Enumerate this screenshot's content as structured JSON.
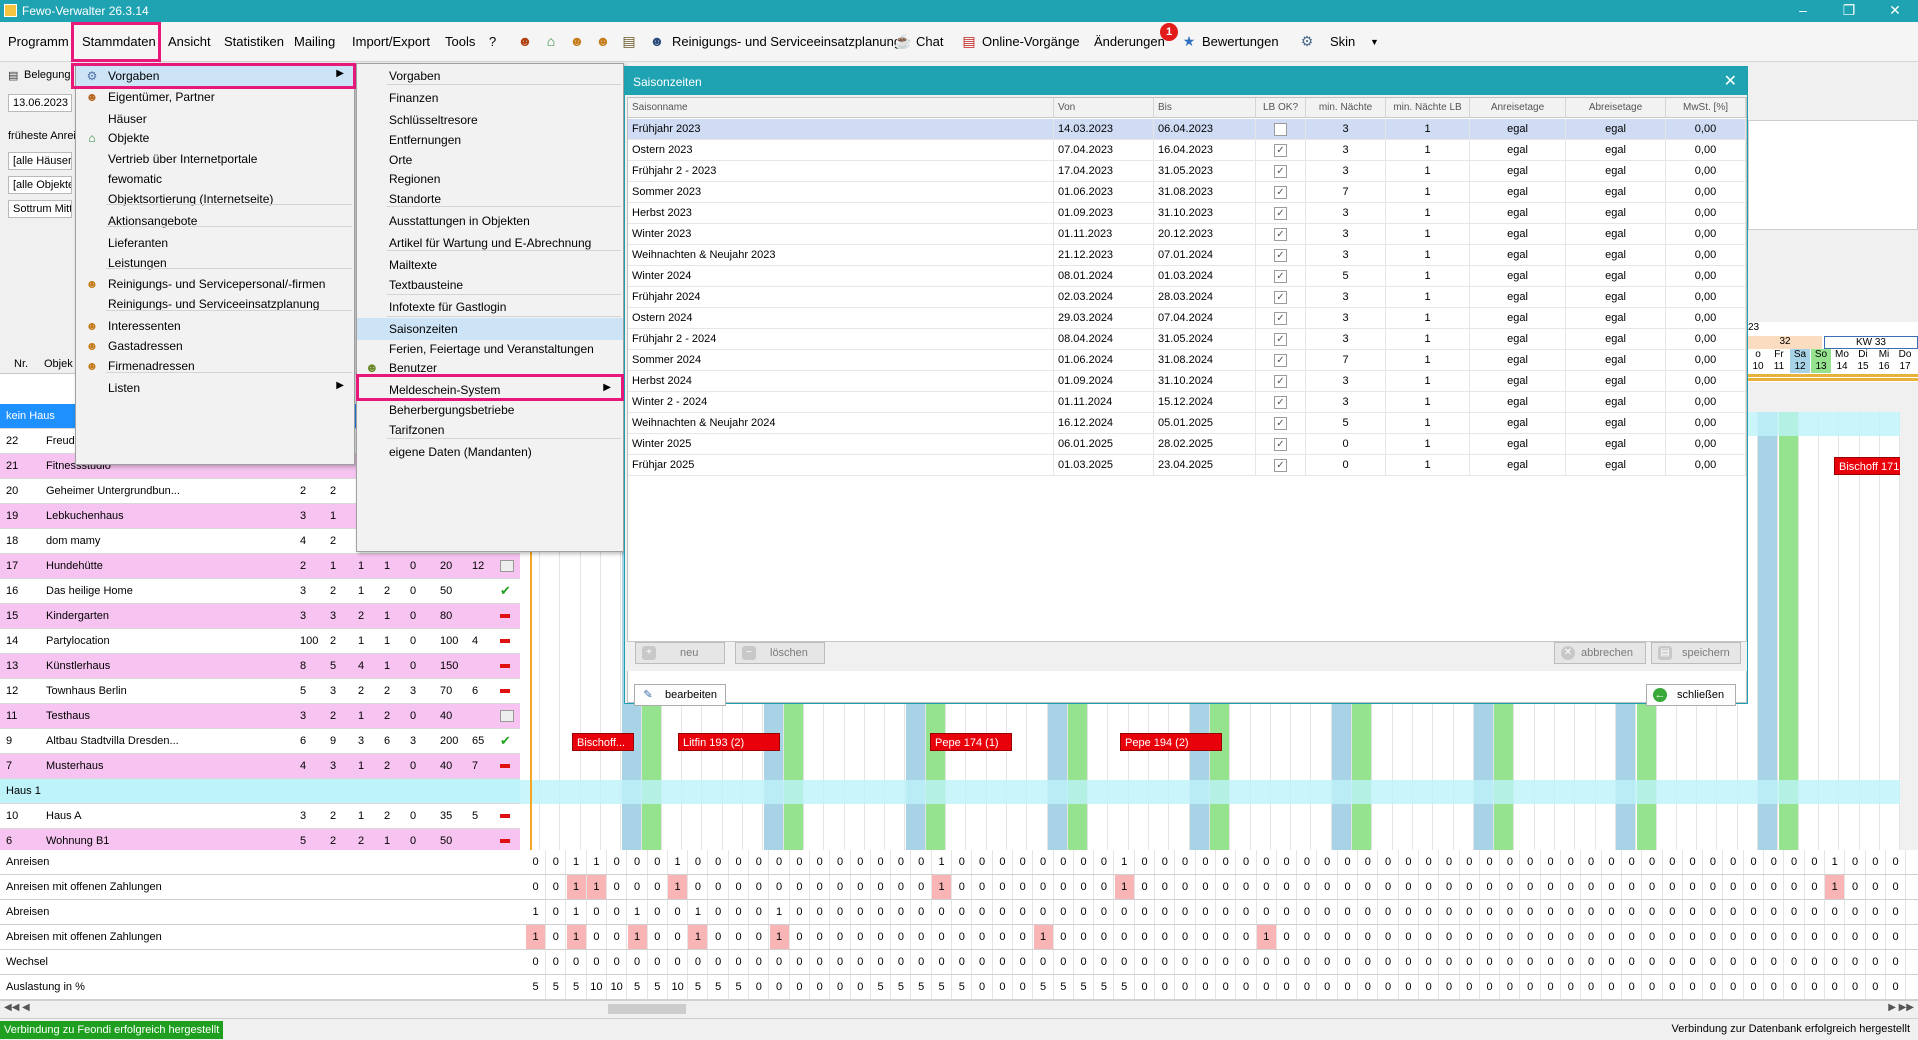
{
  "app": {
    "title": "Fewo-Verwalter 26.3.14"
  },
  "menubar": {
    "items": [
      "Programm",
      "Stammdaten",
      "Ansicht",
      "Statistiken",
      "Mailing",
      "Import/Export",
      "Tools",
      "?"
    ],
    "icon_items": [
      "Reinigungs- und Serviceeinsatzplanung",
      "Chat",
      "Online-Vorgänge",
      "Änderungen",
      "Bewertungen",
      "Skin"
    ],
    "changes_badge": "1"
  },
  "leftpanel": {
    "tab": "Belegung",
    "date": "13.06.2023",
    "earliest_label": "früheste Anrei",
    "filter_houses": "[alle Häuser]",
    "filter_objects": "[alle Objekte]",
    "filter_location": "Sottrum Mitte"
  },
  "menu_stammdaten": {
    "items": [
      {
        "label": "Vorgaben",
        "icon": "settings-icon",
        "submenu": true,
        "selected": true
      },
      {
        "label": "Eigentümer, Partner",
        "icon": "owner-icon"
      },
      {
        "label": "Häuser",
        "icon": ""
      },
      {
        "label": "Objekte",
        "icon": "house-icon"
      },
      {
        "label": "Vertrieb über Internetportale",
        "icon": ""
      },
      {
        "label": "fewomatic",
        "icon": ""
      },
      {
        "label": "Objektsortierung (Internetseite)",
        "icon": ""
      },
      {
        "label": "Aktionsangebote",
        "icon": ""
      },
      {
        "label": "Lieferanten",
        "icon": ""
      },
      {
        "label": "Leistungen",
        "icon": ""
      },
      {
        "label": "Reinigungs- und Servicepersonal/-firmen",
        "icon": "person-icon"
      },
      {
        "label": "Reinigungs- und Serviceeinsatzplanung",
        "icon": ""
      },
      {
        "label": "Interessenten",
        "icon": "person-icon"
      },
      {
        "label": "Gastadressen",
        "icon": "person-icon"
      },
      {
        "label": "Firmenadressen",
        "icon": "person-icon"
      },
      {
        "label": "Listen",
        "icon": "",
        "submenu": true
      }
    ]
  },
  "menu_vorgaben": {
    "items": [
      {
        "label": "Vorgaben"
      },
      {
        "label": "Finanzen"
      },
      {
        "label": "Schlüsseltresore"
      },
      {
        "label": "Entfernungen"
      },
      {
        "label": "Orte"
      },
      {
        "label": "Regionen"
      },
      {
        "label": "Standorte"
      },
      {
        "label": "Ausstattungen in Objekten"
      },
      {
        "label": "Artikel für Wartung und E-Abrechnung"
      },
      {
        "label": "Mailtexte"
      },
      {
        "label": "Textbausteine"
      },
      {
        "label": "Infotexte für Gastlogin"
      },
      {
        "label": "Saisonzeiten",
        "selected": true
      },
      {
        "label": "Ferien, Feiertage und Veranstaltungen"
      },
      {
        "label": "Benutzer"
      },
      {
        "label": "Meldeschein-System",
        "submenu": true
      },
      {
        "label": "Beherbergungsbetriebe"
      },
      {
        "label": "Tarifzonen"
      },
      {
        "label": "eigene Daten (Mandanten)"
      }
    ]
  },
  "dialog": {
    "title": "Saisonzeiten",
    "columns": [
      "Saisonname",
      "Von",
      "Bis",
      "LB OK?",
      "min. Nächte",
      "min. Nächte LB",
      "Anreisetage",
      "Abreisetage",
      "MwSt. [%]"
    ],
    "rows": [
      {
        "name": "Frühjahr 2023",
        "von": "14.03.2023",
        "bis": "06.04.2023",
        "lb": false,
        "min": "3",
        "minlb": "1",
        "an": "egal",
        "ab": "egal",
        "mwst": "0,00"
      },
      {
        "name": "Ostern 2023",
        "von": "07.04.2023",
        "bis": "16.04.2023",
        "lb": true,
        "min": "3",
        "minlb": "1",
        "an": "egal",
        "ab": "egal",
        "mwst": "0,00"
      },
      {
        "name": "Frühjahr 2 - 2023",
        "von": "17.04.2023",
        "bis": "31.05.2023",
        "lb": true,
        "min": "3",
        "minlb": "1",
        "an": "egal",
        "ab": "egal",
        "mwst": "0,00"
      },
      {
        "name": "Sommer 2023",
        "von": "01.06.2023",
        "bis": "31.08.2023",
        "lb": true,
        "min": "7",
        "minlb": "1",
        "an": "egal",
        "ab": "egal",
        "mwst": "0,00"
      },
      {
        "name": "Herbst 2023",
        "von": "01.09.2023",
        "bis": "31.10.2023",
        "lb": true,
        "min": "3",
        "minlb": "1",
        "an": "egal",
        "ab": "egal",
        "mwst": "0,00"
      },
      {
        "name": "Winter 2023",
        "von": "01.11.2023",
        "bis": "20.12.2023",
        "lb": true,
        "min": "3",
        "minlb": "1",
        "an": "egal",
        "ab": "egal",
        "mwst": "0,00"
      },
      {
        "name": "Weihnachten & Neujahr 2023",
        "von": "21.12.2023",
        "bis": "07.01.2024",
        "lb": true,
        "min": "3",
        "minlb": "1",
        "an": "egal",
        "ab": "egal",
        "mwst": "0,00"
      },
      {
        "name": "Winter 2024",
        "von": "08.01.2024",
        "bis": "01.03.2024",
        "lb": true,
        "min": "5",
        "minlb": "1",
        "an": "egal",
        "ab": "egal",
        "mwst": "0,00"
      },
      {
        "name": "Frühjahr 2024",
        "von": "02.03.2024",
        "bis": "28.03.2024",
        "lb": true,
        "min": "3",
        "minlb": "1",
        "an": "egal",
        "ab": "egal",
        "mwst": "0,00"
      },
      {
        "name": "Ostern 2024",
        "von": "29.03.2024",
        "bis": "07.04.2024",
        "lb": true,
        "min": "3",
        "minlb": "1",
        "an": "egal",
        "ab": "egal",
        "mwst": "0,00"
      },
      {
        "name": "Frühjahr 2 - 2024",
        "von": "08.04.2024",
        "bis": "31.05.2024",
        "lb": true,
        "min": "3",
        "minlb": "1",
        "an": "egal",
        "ab": "egal",
        "mwst": "0,00"
      },
      {
        "name": "Sommer 2024",
        "von": "01.06.2024",
        "bis": "31.08.2024",
        "lb": true,
        "min": "7",
        "minlb": "1",
        "an": "egal",
        "ab": "egal",
        "mwst": "0,00"
      },
      {
        "name": "Herbst 2024",
        "von": "01.09.2024",
        "bis": "31.10.2024",
        "lb": true,
        "min": "3",
        "minlb": "1",
        "an": "egal",
        "ab": "egal",
        "mwst": "0,00"
      },
      {
        "name": "Winter 2 - 2024",
        "von": "01.11.2024",
        "bis": "15.12.2024",
        "lb": true,
        "min": "3",
        "minlb": "1",
        "an": "egal",
        "ab": "egal",
        "mwst": "0,00"
      },
      {
        "name": "Weihnachten & Neujahr 2024",
        "von": "16.12.2024",
        "bis": "05.01.2025",
        "lb": true,
        "min": "5",
        "minlb": "1",
        "an": "egal",
        "ab": "egal",
        "mwst": "0,00"
      },
      {
        "name": "Winter 2025",
        "von": "06.01.2025",
        "bis": "28.02.2025",
        "lb": true,
        "min": "0",
        "minlb": "1",
        "an": "egal",
        "ab": "egal",
        "mwst": "0,00"
      },
      {
        "name": "Frühjar 2025",
        "von": "01.03.2025",
        "bis": "23.04.2025",
        "lb": true,
        "min": "0",
        "minlb": "1",
        "an": "egal",
        "ab": "egal",
        "mwst": "0,00"
      }
    ],
    "buttons": {
      "new": "neu",
      "delete": "löschen",
      "cancel": "abbrechen",
      "save": "speichern",
      "edit": "bearbeiten",
      "close": "schließen"
    }
  },
  "grid": {
    "header_nr": "Nr.",
    "header_obj": "Objek",
    "group_kein_haus": "kein Haus",
    "group_haus1": "Haus 1",
    "rows": [
      {
        "nr": "22",
        "name": "Freudi",
        "vals": [
          "",
          "",
          "",
          "",
          "",
          "",
          ""
        ],
        "color": "white",
        "status": ""
      },
      {
        "nr": "21",
        "name": "Fitnessstudio",
        "vals": [
          "",
          "",
          "",
          "",
          "",
          "",
          ""
        ],
        "color": "pink",
        "status": ""
      },
      {
        "nr": "20",
        "name": "Geheimer Untergrundbun...",
        "vals": [
          "2",
          "2",
          "",
          "",
          "",
          "",
          ""
        ],
        "color": "white",
        "status": ""
      },
      {
        "nr": "19",
        "name": "Lebkuchenhaus",
        "vals": [
          "3",
          "1",
          "",
          "",
          "",
          "",
          ""
        ],
        "color": "pink",
        "status": ""
      },
      {
        "nr": "18",
        "name": "dom mamy",
        "vals": [
          "4",
          "2",
          "",
          "",
          "",
          "",
          ""
        ],
        "color": "white",
        "status": ""
      },
      {
        "nr": "17",
        "name": "Hundehütte",
        "vals": [
          "2",
          "1",
          "1",
          "1",
          "0",
          "20",
          "12"
        ],
        "color": "pink",
        "status": "calendar"
      },
      {
        "nr": "16",
        "name": "Das heilige Home",
        "vals": [
          "3",
          "2",
          "1",
          "2",
          "0",
          "50",
          ""
        ],
        "color": "white",
        "status": "check"
      },
      {
        "nr": "15",
        "name": "Kindergarten",
        "vals": [
          "3",
          "3",
          "2",
          "1",
          "0",
          "80",
          ""
        ],
        "color": "pink",
        "status": "minus"
      },
      {
        "nr": "14",
        "name": "Partylocation",
        "vals": [
          "100",
          "2",
          "1",
          "1",
          "0",
          "100",
          "4"
        ],
        "color": "white",
        "status": "minus"
      },
      {
        "nr": "13",
        "name": "Künstlerhaus",
        "vals": [
          "8",
          "5",
          "4",
          "1",
          "0",
          "150",
          ""
        ],
        "color": "pink",
        "status": "minus"
      },
      {
        "nr": "12",
        "name": "Townhaus Berlin",
        "vals": [
          "5",
          "3",
          "2",
          "2",
          "3",
          "70",
          "6"
        ],
        "color": "white",
        "status": "minus"
      },
      {
        "nr": "11",
        "name": "Testhaus",
        "vals": [
          "3",
          "2",
          "1",
          "2",
          "0",
          "40",
          ""
        ],
        "color": "pink",
        "status": "calendar"
      },
      {
        "nr": "9",
        "name": "Altbau Stadtvilla Dresden...",
        "vals": [
          "6",
          "9",
          "3",
          "6",
          "3",
          "200",
          "65"
        ],
        "color": "white",
        "status": "check"
      },
      {
        "nr": "7",
        "name": "Musterhaus",
        "vals": [
          "4",
          "3",
          "1",
          "2",
          "0",
          "40",
          "7"
        ],
        "color": "pink",
        "status": "minus"
      }
    ],
    "rows_haus1": [
      {
        "nr": "10",
        "name": "Haus A",
        "vals": [
          "3",
          "2",
          "1",
          "2",
          "0",
          "35",
          "5"
        ],
        "color": "white",
        "status": "minus"
      },
      {
        "nr": "6",
        "name": "Wohnung B1",
        "vals": [
          "5",
          "2",
          "2",
          "1",
          "0",
          "50",
          ""
        ],
        "color": "pink",
        "status": "minus"
      }
    ]
  },
  "calendar": {
    "year_fragment": "23",
    "kw32": "32",
    "kw33": "KW 33",
    "days": [
      "o",
      "Fr",
      "Sa",
      "So",
      "Mo",
      "Di",
      "Mi",
      "Do"
    ],
    "dates": [
      "10",
      "11",
      "12",
      "13",
      "14",
      "15",
      "16",
      "17"
    ],
    "bookings": [
      "Bischoff...",
      "Litfin 193 (2)",
      "Pepe  174 (1)",
      "Pepe  194 (2)",
      "Bischoff 171"
    ]
  },
  "summary": {
    "labels": [
      "Anreisen",
      "Anreisen mit offenen Zahlungen",
      "Abreisen",
      "Abreisen mit offenen Zahlungen",
      "Wechsel",
      "Auslastung in %"
    ],
    "anreisen": [
      "0",
      "0",
      "1",
      "1",
      "0",
      "0",
      "0",
      "1",
      "0",
      "0",
      "0",
      "0",
      "0",
      "0",
      "0",
      "0",
      "0",
      "0",
      "0",
      "0",
      "1",
      "0",
      "0",
      "0",
      "0",
      "0",
      "0",
      "0",
      "0",
      "1",
      "0",
      "0",
      "0",
      "0",
      "0",
      "0",
      "0",
      "0",
      "0",
      "0",
      "0",
      "0",
      "0",
      "0",
      "0",
      "0",
      "0",
      "0",
      "0",
      "0",
      "0",
      "0",
      "0",
      "0",
      "0",
      "0",
      "0",
      "0",
      "0",
      "0",
      "0",
      "0",
      "0",
      "0",
      "1",
      "0",
      "0",
      "0"
    ],
    "anreisen_op": [
      "0",
      "0",
      "1",
      "1",
      "0",
      "0",
      "0",
      "1",
      "0",
      "0",
      "0",
      "0",
      "0",
      "0",
      "0",
      "0",
      "0",
      "0",
      "0",
      "0",
      "1",
      "0",
      "0",
      "0",
      "0",
      "0",
      "0",
      "0",
      "0",
      "1",
      "0",
      "0",
      "0",
      "0",
      "0",
      "0",
      "0",
      "0",
      "0",
      "0",
      "0",
      "0",
      "0",
      "0",
      "0",
      "0",
      "0",
      "0",
      "0",
      "0",
      "0",
      "0",
      "0",
      "0",
      "0",
      "0",
      "0",
      "0",
      "0",
      "0",
      "0",
      "0",
      "0",
      "0",
      "1",
      "0",
      "0",
      "0"
    ],
    "abreisen": [
      "1",
      "0",
      "1",
      "0",
      "0",
      "1",
      "0",
      "0",
      "1",
      "0",
      "0",
      "0",
      "1",
      "0",
      "0",
      "0",
      "0",
      "0",
      "0",
      "0",
      "0",
      "0",
      "0",
      "0",
      "0",
      "0",
      "0",
      "0",
      "0",
      "0",
      "0",
      "0",
      "0",
      "0",
      "0",
      "0",
      "0",
      "0",
      "0",
      "0",
      "0",
      "0",
      "0",
      "0",
      "0",
      "0",
      "0",
      "0",
      "0",
      "0",
      "0",
      "0",
      "0",
      "0",
      "0",
      "0",
      "0",
      "0",
      "0",
      "0",
      "0",
      "0",
      "0",
      "0",
      "0",
      "0",
      "0",
      "0"
    ],
    "abreisen_op": [
      "1",
      "0",
      "1",
      "0",
      "0",
      "1",
      "0",
      "0",
      "1",
      "0",
      "0",
      "0",
      "1",
      "0",
      "0",
      "0",
      "0",
      "0",
      "0",
      "0",
      "0",
      "0",
      "0",
      "0",
      "0",
      "1",
      "0",
      "0",
      "0",
      "0",
      "0",
      "0",
      "0",
      "0",
      "0",
      "0",
      "1",
      "0",
      "0",
      "0",
      "0",
      "0",
      "0",
      "0",
      "0",
      "0",
      "0",
      "0",
      "0",
      "0",
      "0",
      "0",
      "0",
      "0",
      "0",
      "0",
      "0",
      "0",
      "0",
      "0",
      "0",
      "0",
      "0",
      "0",
      "0",
      "0",
      "0",
      "0"
    ],
    "wechsel": [
      "0",
      "0",
      "0",
      "0",
      "0",
      "0",
      "0",
      "0",
      "0",
      "0",
      "0",
      "0",
      "0",
      "0",
      "0",
      "0",
      "0",
      "0",
      "0",
      "0",
      "0",
      "0",
      "0",
      "0",
      "0",
      "0",
      "0",
      "0",
      "0",
      "0",
      "0",
      "0",
      "0",
      "0",
      "0",
      "0",
      "0",
      "0",
      "0",
      "0",
      "0",
      "0",
      "0",
      "0",
      "0",
      "0",
      "0",
      "0",
      "0",
      "0",
      "0",
      "0",
      "0",
      "0",
      "0",
      "0",
      "0",
      "0",
      "0",
      "0",
      "0",
      "0",
      "0",
      "0",
      "0",
      "0",
      "0",
      "0"
    ],
    "auslastung": [
      "5",
      "5",
      "5",
      "10",
      "10",
      "5",
      "5",
      "10",
      "5",
      "5",
      "5",
      "0",
      "0",
      "0",
      "0",
      "0",
      "0",
      "5",
      "5",
      "5",
      "5",
      "5",
      "0",
      "0",
      "0",
      "5",
      "5",
      "5",
      "5",
      "5",
      "0",
      "0",
      "0",
      "0",
      "0",
      "0",
      "0",
      "0",
      "0",
      "0",
      "0",
      "0",
      "0",
      "0",
      "0",
      "0",
      "0",
      "0",
      "0",
      "0",
      "0",
      "0",
      "0",
      "0",
      "0",
      "0",
      "0",
      "0",
      "0",
      "0",
      "0",
      "0",
      "0",
      "0",
      "0",
      "0",
      "0",
      "0"
    ]
  },
  "status": {
    "left": "Verbindung zu Feondi erfolgreich hergestellt",
    "right": "Verbindung zur Datenbank erfolgreich hergestellt"
  }
}
